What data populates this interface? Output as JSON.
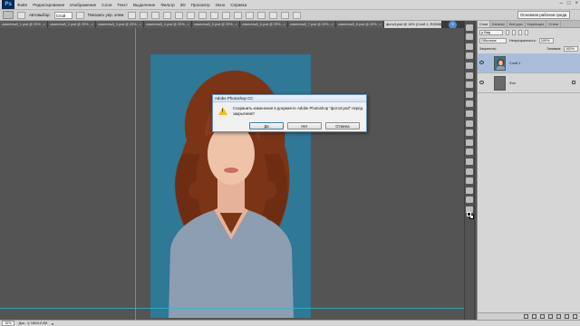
{
  "app": {
    "logo": "Ps"
  },
  "menu": [
    "Файл",
    "Редактирование",
    "Изображение",
    "Слои",
    "Текст",
    "Выделение",
    "Фильтр",
    "3D",
    "Просмотр",
    "Окно",
    "Справка"
  ],
  "options": {
    "autoselect_label": "Автовыбор:",
    "autoselect_value": "Слой",
    "show_controls_label": "Показать упр. элем."
  },
  "workspace": {
    "value": "Основная рабочая среда"
  },
  "tabs": [
    {
      "label": "каменный_1.psd @ 25%...",
      "close": "×"
    },
    {
      "label": "каменный_2.psd @ 25%...",
      "close": "×"
    },
    {
      "label": "каменный_3.psd @ 25%...",
      "close": "×"
    },
    {
      "label": "каменный_4.psd @ 25%...",
      "close": "×"
    },
    {
      "label": "каменный_5.psd @ 25%...",
      "close": "×"
    },
    {
      "label": "каменный_6.psd @ 25%...",
      "close": "×"
    },
    {
      "label": "каменный_7.psd @ 25%...",
      "close": "×"
    },
    {
      "label": "каменный_8.psd @ 25%...",
      "close": "×"
    },
    {
      "label": "фото3.psd @ 16% (Слой 1, RGB/8) *",
      "close": "×"
    }
  ],
  "tabs_more": "»",
  "dialog": {
    "title": "Adobe Photoshop CC",
    "message": "Сохранить изменения в документе Adobe Photoshop \"фото3.psd\" перед закрытием?",
    "buttons": {
      "yes": "Да",
      "no": "Нет",
      "cancel": "Отмена"
    }
  },
  "panels": {
    "tabs": [
      "Слои",
      "Каналы",
      "Контуры",
      "Коррекция",
      "Стили"
    ],
    "filter_label": "ρ Вид",
    "blend_mode": "Обычные",
    "opacity_label": "Непрозрачность:",
    "opacity_value": "100%",
    "lock_label": "Закрепить:",
    "fill_label": "Заливка:",
    "fill_value": "100%",
    "layers": [
      {
        "name": "Слой 1",
        "selected": true
      },
      {
        "name": "Фон",
        "selected": false
      }
    ]
  },
  "status": {
    "zoom": "16%",
    "doc": "Док.: 4,76M/10,9M"
  },
  "colors": {
    "accent": "#4f8fd1",
    "guide": "#2fb6c8",
    "photo_bg": "#2f7896",
    "hair": "#8a3b1a",
    "sweater": "#8d9db2"
  }
}
